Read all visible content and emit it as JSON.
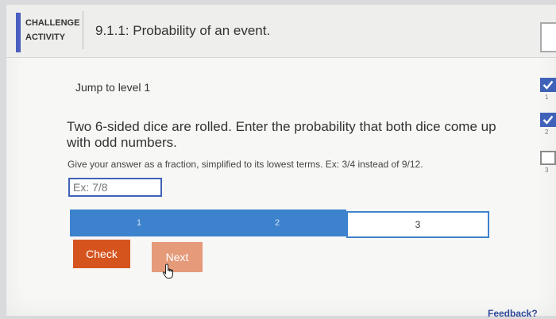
{
  "header": {
    "challenge_label": "CHALLENGE ACTIVITY",
    "title": "9.1.1: Probability of an event."
  },
  "jump_link": "Jump to level 1",
  "question": "Two 6-sided dice are rolled. Enter the probability that both dice come up with odd numbers.",
  "instructions": "Give your answer as a fraction, simplified to its lowest terms. Ex: 3/4 instead of 9/12.",
  "answer_input": {
    "value": "",
    "placeholder": "Ex: 7/8"
  },
  "progress": {
    "segments": [
      {
        "label": "1",
        "status": "complete"
      },
      {
        "label": "2",
        "status": "complete"
      },
      {
        "label": "3",
        "status": "current"
      }
    ]
  },
  "buttons": {
    "check": "Check",
    "next": "Next"
  },
  "feedback_link": "Feedback?",
  "level_rail": {
    "levels": [
      {
        "number": "1",
        "status": "complete",
        "icon": "checkmark-icon"
      },
      {
        "number": "2",
        "status": "complete",
        "icon": "checkmark-icon"
      },
      {
        "number": "3",
        "status": "open",
        "icon": "empty-box-icon"
      }
    ]
  },
  "colors": {
    "accent_blue": "#3f62b8",
    "progress_blue": "#3d82cc",
    "check_orange": "#d5541e",
    "next_orange_disabled": "#e59a7a"
  }
}
